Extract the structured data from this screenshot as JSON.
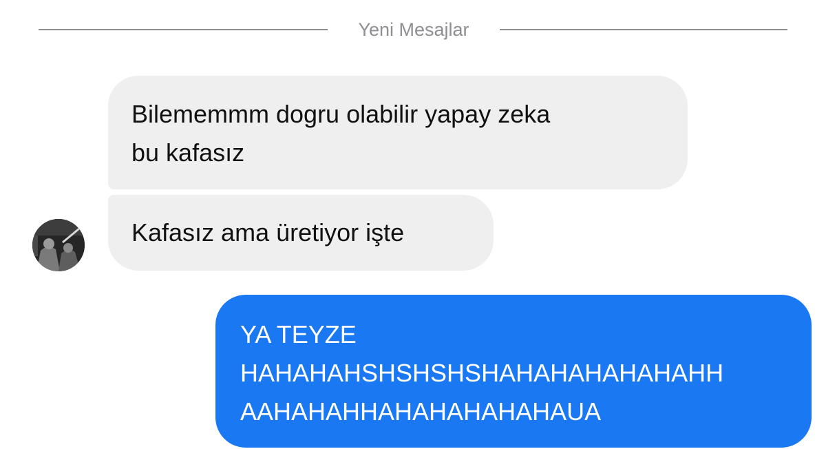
{
  "divider": {
    "label": "Yeni Mesajlar"
  },
  "messages": [
    {
      "direction": "incoming",
      "lines": [
        "Bilememmm dogru olabilir yapay zeka",
        "bu kafasız"
      ]
    },
    {
      "direction": "incoming",
      "lines": [
        "Kafasız ama üretiyor işte"
      ]
    },
    {
      "direction": "outgoing",
      "lines": [
        "YA TEYZE",
        "HAHAHAHSHSHSHSHAHAHAHAHAHAHH",
        "AAHAHAHHAHAHAHAHAHAUA"
      ]
    }
  ],
  "avatar": {
    "icon": "contact-avatar-photo"
  },
  "colors": {
    "incoming_bubble": "#efefef",
    "outgoing_bubble": "#1a78f2",
    "divider": "#8e8e93"
  }
}
